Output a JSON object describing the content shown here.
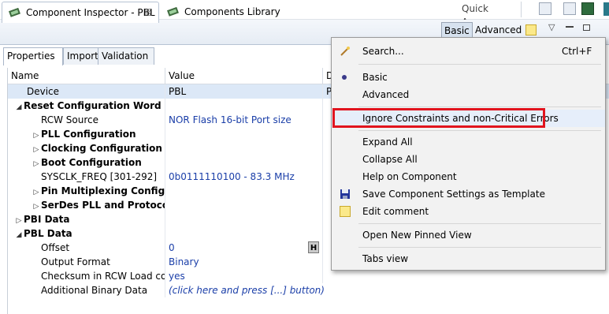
{
  "toolbar": {
    "quick_access": "Quick Access"
  },
  "view_tabs": {
    "inspector": "Component Inspector - PBL",
    "inspector_close": "☒",
    "library": "Components Library"
  },
  "mode": {
    "basic": "Basic",
    "advanced": "Advanced"
  },
  "subtabs": [
    "Properties",
    "Import",
    "Validation"
  ],
  "columns": {
    "name": "Name",
    "value": "Value",
    "d": "D"
  },
  "rows": [
    {
      "name": "Device",
      "value": "PBL",
      "d": "P"
    },
    {
      "name": "Reset Configuration Word (RCW",
      "value": ""
    },
    {
      "name": "RCW Source",
      "value": "NOR Flash 16-bit Port size"
    },
    {
      "name": "PLL Configuration",
      "value": ""
    },
    {
      "name": "Clocking Configuration",
      "value": ""
    },
    {
      "name": "Boot Configuration",
      "value": ""
    },
    {
      "name": "SYSCLK_FREQ [301-292]",
      "value": "0b0111110100 - 83.3 MHz"
    },
    {
      "name": "Pin Multiplexing Configurati",
      "value": ""
    },
    {
      "name": "SerDes PLL and Protocol Cor",
      "value": ""
    },
    {
      "name": "PBI Data",
      "value": ""
    },
    {
      "name": "PBL Data",
      "value": ""
    },
    {
      "name": "Offset",
      "value": "0",
      "badge": "H"
    },
    {
      "name": "Output Format",
      "value": "Binary"
    },
    {
      "name": "Checksum in RCW Load comi",
      "value": "yes"
    },
    {
      "name": "Additional Binary Data",
      "value": "(click here and press [...] button)"
    }
  ],
  "menu": {
    "search": "Search...",
    "search_shortcut": "Ctrl+F",
    "basic": "Basic",
    "advanced": "Advanced",
    "ignore": "Ignore Constraints and non-Critical Errors",
    "expand_all": "Expand All",
    "collapse_all": "Collapse All",
    "help": "Help on Component",
    "save_template": "Save Component Settings as Template",
    "edit_comment": "Edit comment",
    "open_pinned": "Open New Pinned View",
    "tabs_view": "Tabs view"
  },
  "colors": {
    "highlight_box": "#e1141e",
    "value_text": "#1a3ea8",
    "selected_row": "#dce8f7"
  }
}
